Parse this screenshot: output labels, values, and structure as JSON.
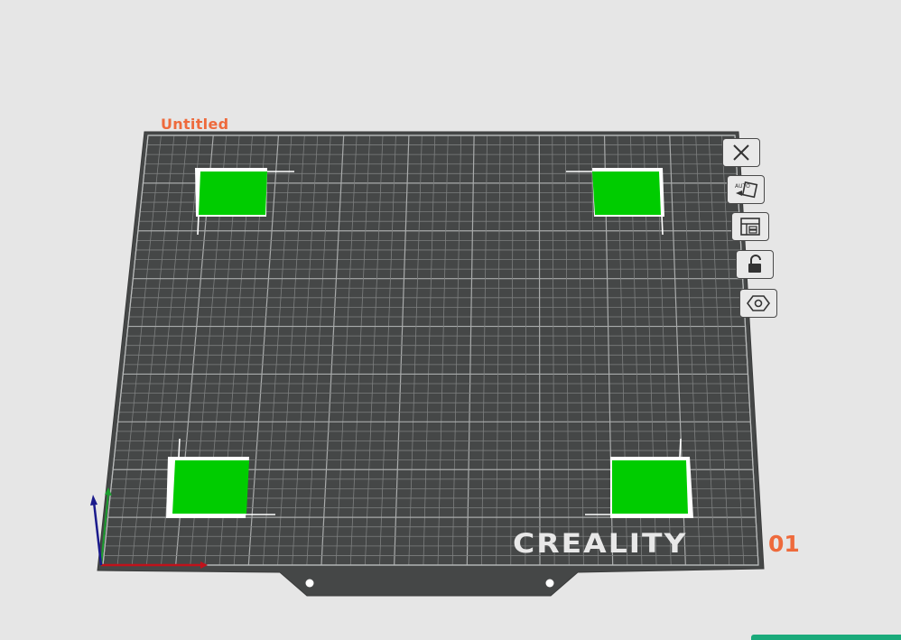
{
  "plate": {
    "title": "Untitled",
    "number": "01",
    "brand": "CREALITY"
  },
  "toolbar": {
    "buttons": [
      {
        "name": "delete-plate-button",
        "icon": "close-icon"
      },
      {
        "name": "auto-arrange-button",
        "icon": "auto-orient-icon"
      },
      {
        "name": "arrange-button",
        "icon": "layout-icon"
      },
      {
        "name": "lock-plate-button",
        "icon": "unlock-icon"
      },
      {
        "name": "plate-settings-button",
        "icon": "hexagon-gear-icon"
      }
    ]
  },
  "objects": {
    "count": 4,
    "color": "#00cc00"
  },
  "colors": {
    "background": "#e6e6e6",
    "plate": "#454747",
    "grid": "#8d8f8f",
    "accent": "#ee6a3c",
    "axis_x": "#c0121b",
    "axis_y": "#1b9e2f",
    "axis_z": "#1a1a8c"
  }
}
